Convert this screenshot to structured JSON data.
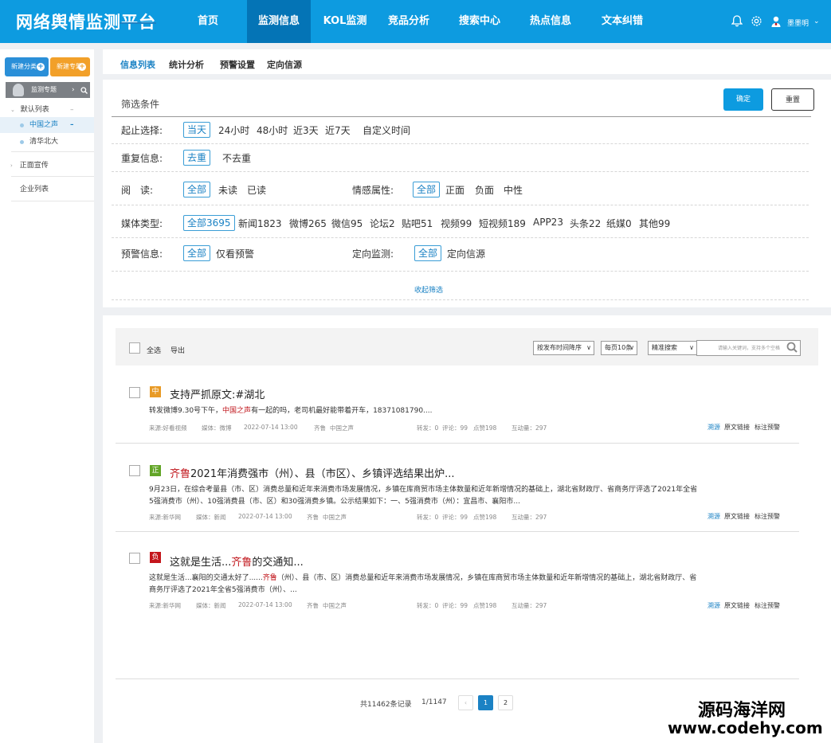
{
  "header": {
    "logo": "网络舆情监测平台",
    "nav": [
      "首页",
      "监测信息",
      "KOL监测",
      "竞品分析",
      "搜索中心",
      "热点信息",
      "文本纠错"
    ],
    "active_nav": 1,
    "icons": [
      "bell-icon",
      "gear-icon",
      "user-icon"
    ],
    "username": "墨墨明",
    "caret": "⌄"
  },
  "sidebar": {
    "new_category": "新建分类",
    "new_topic": "新建专题",
    "plus": "+",
    "topic_header": "监测专题",
    "arrow": "›",
    "search_glyph": "⚲",
    "default_list": "默认列表",
    "default_list_toggle": "–",
    "items": [
      "中国之声",
      "清华北大"
    ],
    "item_marker": "–",
    "positive": "正面宣传",
    "enterprise": "企业列表",
    "colors": {
      "new_category": "#2a8fd8",
      "new_topic": "#f2a029"
    }
  },
  "tabs": [
    "信息列表",
    "统计分析",
    "预警设置",
    "定向信源"
  ],
  "filter": {
    "title": "筛选条件",
    "confirm": "确定",
    "reset": "重置",
    "time": {
      "label": "起止选择:",
      "options": [
        "当天",
        "24小时",
        "48小时",
        "近3天",
        "近7天",
        "自定义时间"
      ]
    },
    "dup": {
      "label": "重复信息:",
      "options": [
        "去重",
        "不去重"
      ]
    },
    "read": {
      "label": "阅　读:",
      "options": [
        "全部",
        "未读",
        "已读"
      ]
    },
    "sentiment": {
      "label": "情感属性:",
      "options": [
        "全部",
        "正面",
        "负面",
        "中性"
      ]
    },
    "media": {
      "label": "媒体类型:",
      "options": [
        "全部3695",
        "新闻1823",
        "微博265",
        "微信95",
        "论坛2",
        "贴吧51",
        "视频99",
        "短视频189",
        "APP23",
        "头条22",
        "纸媒0",
        "其他99"
      ]
    },
    "alert": {
      "label": "预警信息:",
      "options": [
        "全部",
        "仅看预警"
      ]
    },
    "directed": {
      "label": "定向监测:",
      "options": [
        "全部",
        "定向信源"
      ]
    },
    "collapse": "收起筛选"
  },
  "list": {
    "select_all": "全选",
    "export": "导出",
    "sort": "按发布时间降序",
    "per_page": "每页10条",
    "precise": "精准搜索",
    "search_placeholder": "请输入关键词，支持多个空格",
    "search_icon": "search-icon",
    "items": [
      {
        "badge": "中",
        "badge_color": "#e89a25",
        "title_pre": "支持严抓原文:#湖北",
        "title_red": "",
        "title_post": "",
        "sum_pre": "转发微博9.30号下午，",
        "sum_red": "中国之声",
        "sum_post": "有一起的吗，老司机最好能带着开车，18371081790....",
        "source": "来源:好看视频",
        "media": "媒体：微博",
        "time": "2022-07-14  13:00",
        "qilu": "齐鲁",
        "org": "中国之声",
        "forward": "转发：0",
        "comment": "评论：99",
        "like": "点赞198",
        "interact": "互动量：297"
      },
      {
        "badge": "正",
        "badge_color": "#62a527",
        "title_pre": "",
        "title_red": "齐鲁",
        "title_post": "2021年消费强市（州）、县（市区）、乡镇评选结果出炉...",
        "sum_pre": "9月23日，在综合考量县（市、区）消费总量和近年来消费市场发展情况，乡镇在库商贸市场主体数量和近年新增情况的基础上，湖北省财政厅、省商务厅评选了2021年全省5强消费市（州）、10强消费县（市、区）和30强消费乡镇。公示结果如下：一、5强消费市（州）：宜昌市、襄阳市...",
        "sum_red": "",
        "sum_post": "",
        "source": "来源:新华网",
        "media": "媒体：新闻",
        "time": "2022-07-14  13:00",
        "qilu": "齐鲁",
        "org": "中国之声",
        "forward": "转发：0",
        "comment": "评论：99",
        "like": "点赞198",
        "interact": "互动量：297"
      },
      {
        "badge": "负",
        "badge_color": "#c4161c",
        "title_pre": "这就是生活...",
        "title_red": "齐鲁",
        "title_post": "的交通知...",
        "sum_pre": "这就是生活...襄阳的交通太好了......",
        "sum_red": "齐鲁",
        "sum_post": "（州）、县（市、区）消费总量和近年来消费市场发展情况，乡镇在库商贸市场主体数量和近年新增情况的基础上，湖北省财政厅、省商务厅评选了2021年全省5强消费市（州）、...",
        "source": "来源:新华网",
        "media": "媒体：新闻",
        "time": "2022-07-14  13:00",
        "qilu": "齐鲁",
        "org": "中国之声",
        "forward": "转发：0",
        "comment": "评论：99",
        "like": "点赞198",
        "interact": "互动量：297"
      }
    ],
    "actions": [
      "溯源",
      "原文链接",
      "标注预警"
    ]
  },
  "pagination": {
    "total": "共11462条记录",
    "pages": "1/1147",
    "prev": "‹",
    "p1": "1",
    "p2": "2"
  },
  "watermark": {
    "line1": "源码海洋网",
    "line2": "www.codehy.com"
  }
}
